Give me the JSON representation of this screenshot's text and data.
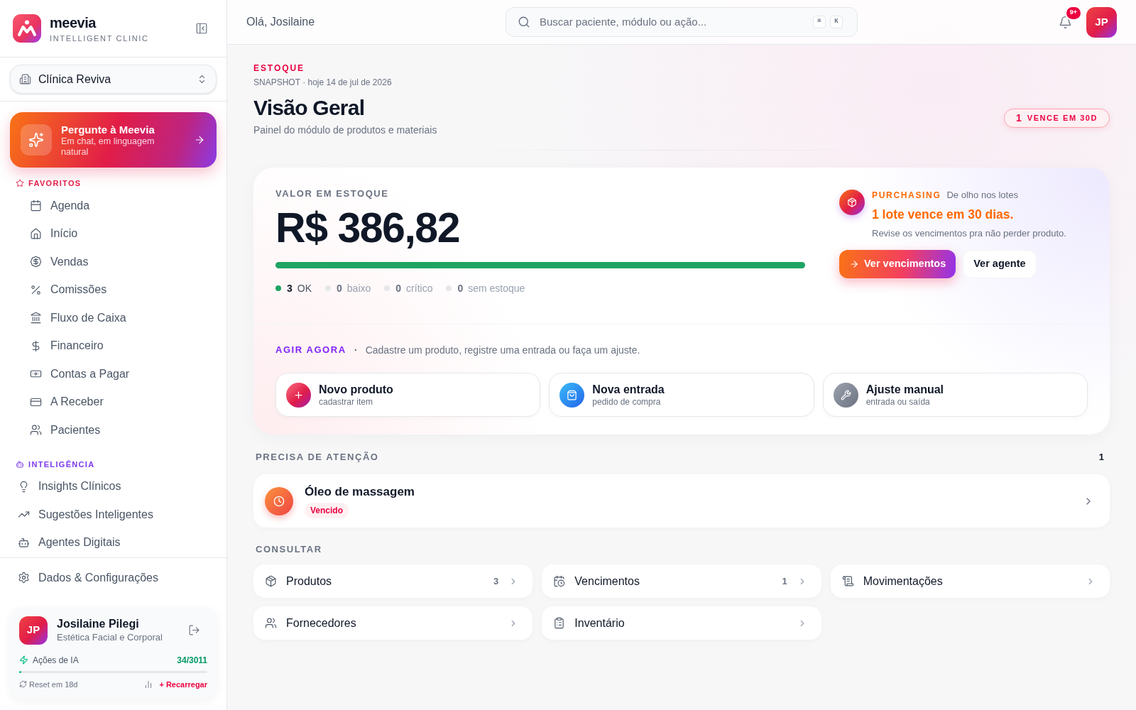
{
  "sidebar": {
    "brand": {
      "name": "meevia",
      "tagline": "INTELLIGENT CLINIC"
    },
    "clinic_selector": {
      "value": "Clínica Reviva"
    },
    "assistant_card": {
      "title": "Pergunte à Meevia",
      "subtitle": "Em chat, em linguagem natural"
    },
    "sections": [
      {
        "kind": "favorites",
        "title": "FAVORITOS",
        "color": "#e11d48",
        "items": [
          {
            "label": "Agenda",
            "selected": false
          },
          {
            "label": "Início",
            "selected": false
          },
          {
            "label": "Vendas",
            "selected": false
          },
          {
            "label": "Comissões",
            "selected": false
          },
          {
            "label": "Fluxo de Caixa",
            "selected": false
          },
          {
            "label": "Financeiro",
            "selected": false
          },
          {
            "label": "Contas a Pagar",
            "selected": false
          },
          {
            "label": "A Receber",
            "selected": false
          },
          {
            "label": "Pacientes",
            "selected": false
          }
        ]
      },
      {
        "kind": "intelligence",
        "title": "INTELIGÊNCIA",
        "color": "#7c3aed",
        "items": [
          {
            "label": "Insights Clínicos",
            "selected": false
          },
          {
            "label": "Sugestões Inteligentes",
            "selected": false
          },
          {
            "label": "Agentes Digitais",
            "selected": false
          }
        ]
      }
    ],
    "settings_item": {
      "label": "Dados & Configurações",
      "selected": false
    },
    "user_card": {
      "initials": "JP",
      "name": "Josilaine Pilegi",
      "role": "Estética Facial e Corporal",
      "ai_actions": {
        "label": "Ações de IA",
        "reading": "34/3011",
        "level": 0.011
      },
      "reset": "Reset em 18d",
      "recharge": "+ Recarregar"
    }
  },
  "header": {
    "greeting": "Olá, Josilaine",
    "search": {
      "placeholder": "Buscar paciente, módulo ou ação...",
      "shortcut": [
        "⌘",
        "K"
      ]
    },
    "notifications_badge": "9+",
    "avatar_initials": "JP"
  },
  "page": {
    "eyebrow": "ESTOQUE",
    "meta": "SNAPSHOT · hoje 14 de jul de 2026",
    "title": "Visão Geral",
    "subtitle": "Painel do módulo de produtos e materiais",
    "alert_badge": {
      "count": "1",
      "label": "VENCE EM 30D"
    }
  },
  "stock_card": {
    "label": "VALOR EM ESTOQUE",
    "value": "R$ 386,82",
    "bar": {
      "level": 1
    },
    "legend": [
      {
        "count": "3",
        "label": "OK",
        "color": "#1fa463",
        "dimmed": false
      },
      {
        "count": "0",
        "label": "baixo",
        "color": "#e5e7eb",
        "dimmed": true
      },
      {
        "count": "0",
        "label": "crítico",
        "color": "#e5e7eb",
        "dimmed": true
      },
      {
        "count": "0",
        "label": "sem estoque",
        "color": "#e5e7eb",
        "dimmed": true
      }
    ],
    "insight": {
      "tag": "PURCHASING",
      "context": "De olho nos lotes",
      "headline": "1 lote vence em 30 dias.",
      "body": "Revise os vencimentos pra não perder produto.",
      "actions": [
        {
          "kind": "primary",
          "label": "Ver vencimentos"
        },
        {
          "kind": "secondary",
          "label": "Ver agente"
        }
      ]
    },
    "quick_actions": {
      "title": "AGIR AGORA",
      "separator": "·",
      "description": "Cadastre um produto, registre uma entrada ou faça um ajuste.",
      "items": [
        {
          "title": "Novo produto",
          "subtitle": "cadastrar item"
        },
        {
          "title": "Nova entrada",
          "subtitle": "pedido de compra"
        },
        {
          "title": "Ajuste manual",
          "subtitle": "entrada ou saída"
        }
      ]
    }
  },
  "attention": {
    "title": "PRECISA DE ATENÇÃO",
    "count": "1",
    "items": [
      {
        "name": "Óleo de massagem",
        "status": "Vencido"
      }
    ]
  },
  "consult": {
    "title": "CONSULTAR",
    "items": [
      {
        "label": "Produtos",
        "count": "3"
      },
      {
        "label": "Vencimentos",
        "count": "1"
      },
      {
        "label": "Movimentações"
      },
      {
        "label": "Fornecedores"
      },
      {
        "label": "Inventário"
      }
    ]
  }
}
